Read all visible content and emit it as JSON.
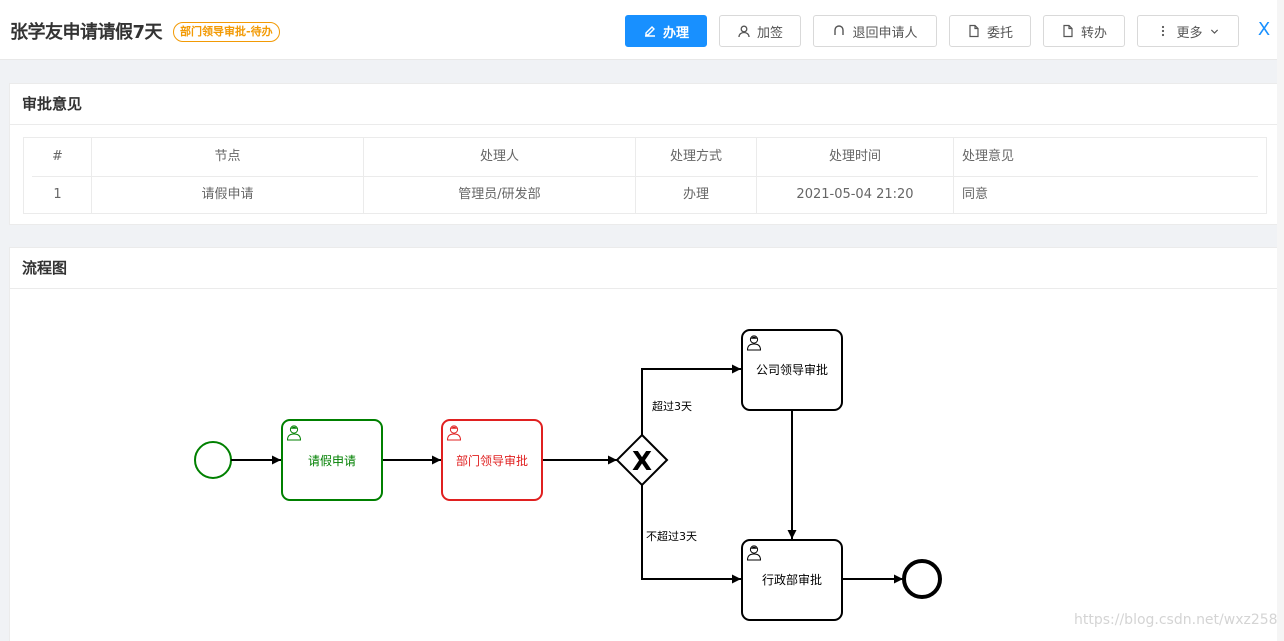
{
  "header": {
    "title": "张学友申请请假7天",
    "status": "部门领导审批-待办",
    "actions": [
      {
        "label": "办理",
        "icon": "edit-icon"
      },
      {
        "label": "加签",
        "icon": "user-icon"
      },
      {
        "label": "退回申请人",
        "icon": "undo-icon"
      },
      {
        "label": "委托",
        "icon": "document-icon"
      },
      {
        "label": "转办",
        "icon": "document-icon"
      },
      {
        "label": "更多",
        "icon": "more-icon"
      }
    ],
    "close_label": "X"
  },
  "approval": {
    "title": "审批意见",
    "columns": [
      "#",
      "节点",
      "处理人",
      "处理方式",
      "处理时间",
      "处理意见"
    ],
    "rows": [
      [
        "1",
        "请假申请",
        "管理员/研发部",
        "办理",
        "2021-05-04 21:20",
        "同意"
      ]
    ]
  },
  "flow": {
    "title": "流程图",
    "tasks": {
      "apply": "请假申请",
      "dept": "部门领导审批",
      "company": "公司领导审批",
      "admin": "行政部审批"
    },
    "gateway_label": "X",
    "conditions": {
      "over": "超过3天",
      "under": "不超过3天"
    },
    "colors": {
      "completed": "#008000",
      "current": "#e02020",
      "pending": "#000000"
    }
  },
  "watermark": "https://blog.csdn.net/wxz258"
}
